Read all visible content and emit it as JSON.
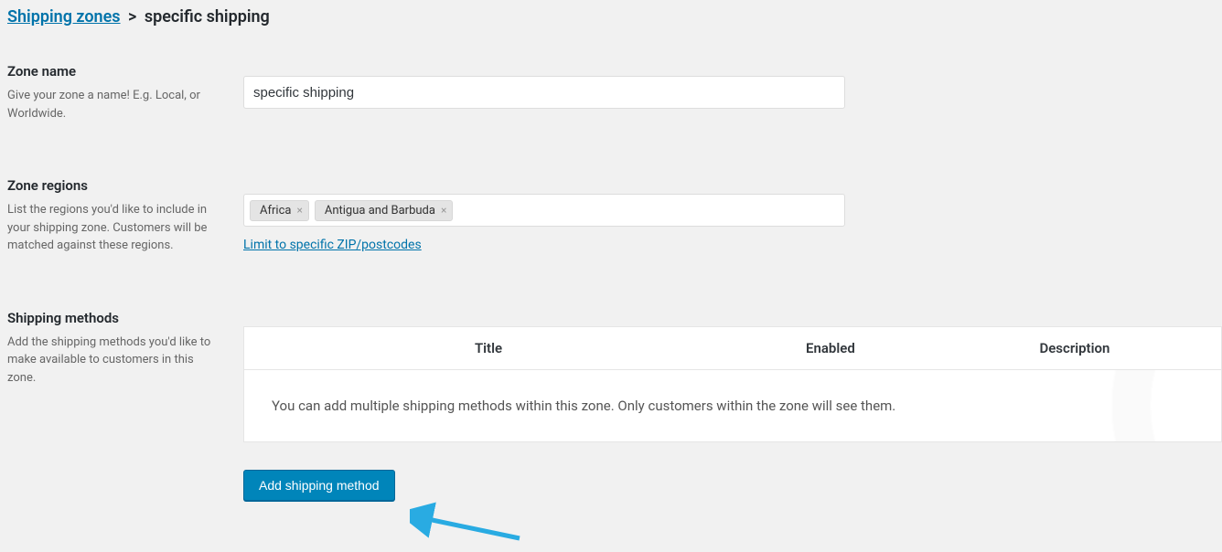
{
  "breadcrumb": {
    "link_text": "Shipping zones",
    "separator": ">",
    "current": "specific shipping"
  },
  "sections": {
    "zone_name": {
      "title": "Zone name",
      "description": "Give your zone a name! E.g. Local, or Worldwide.",
      "value": "specific shipping"
    },
    "zone_regions": {
      "title": "Zone regions",
      "description": "List the regions you'd like to include in your shipping zone. Customers will be matched against these regions.",
      "tags": [
        "Africa",
        "Antigua and Barbuda"
      ],
      "limit_link": "Limit to specific ZIP/postcodes"
    },
    "shipping_methods": {
      "title": "Shipping methods",
      "description": "Add the shipping methods you'd like to make available to customers in this zone.",
      "columns": {
        "title": "Title",
        "enabled": "Enabled",
        "description": "Description"
      },
      "empty_text": "You can add multiple shipping methods within this zone. Only customers within the zone will see them.",
      "add_button": "Add shipping method"
    }
  }
}
